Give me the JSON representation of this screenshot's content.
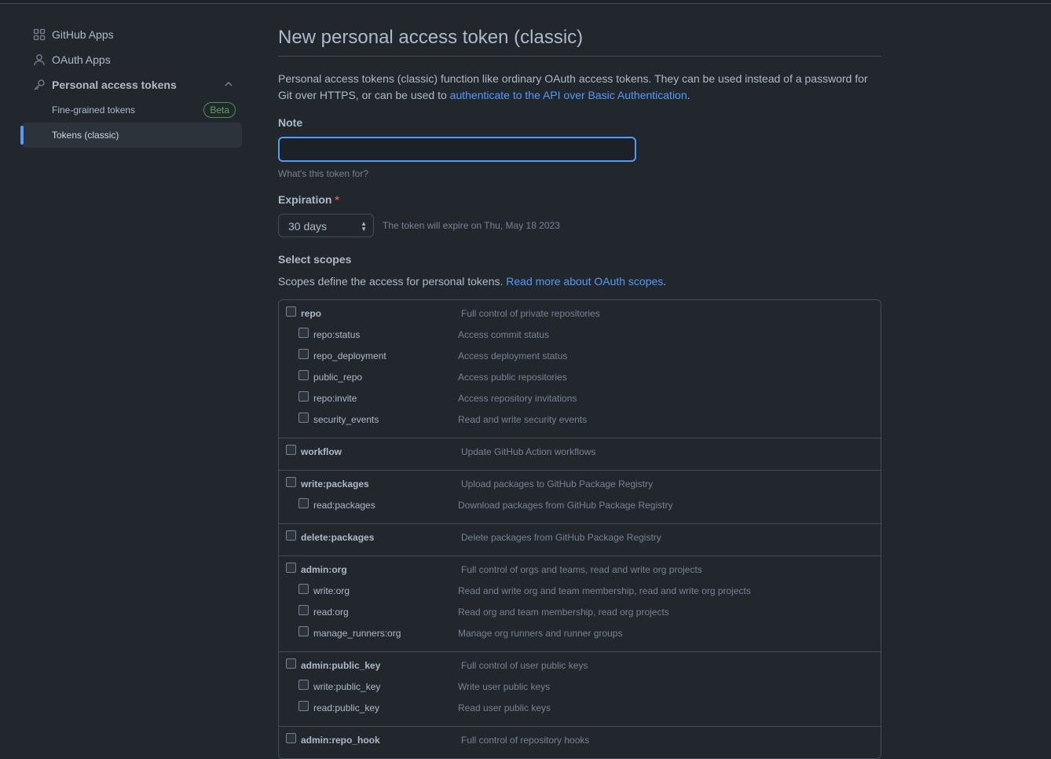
{
  "sidebar": {
    "items": [
      {
        "label": "GitHub Apps",
        "icon": "apps-grid-icon"
      },
      {
        "label": "OAuth Apps",
        "icon": "person-icon"
      },
      {
        "label": "Personal access tokens",
        "icon": "key-icon"
      }
    ],
    "sub_items": [
      {
        "label": "Fine-grained tokens",
        "badge": "Beta"
      },
      {
        "label": "Tokens (classic)",
        "active": true
      }
    ]
  },
  "main": {
    "title": "New personal access token (classic)",
    "description_text": "Personal access tokens (classic) function like ordinary OAuth access tokens. They can be used instead of a password for Git over HTTPS, or can be used to ",
    "description_link": "authenticate to the API over Basic Authentication",
    "description_end": ".",
    "note": {
      "label": "Note",
      "value": "",
      "hint": "What's this token for?"
    },
    "expiration": {
      "label": "Expiration",
      "required_mark": "*",
      "selected": "30 days",
      "note": "The token will expire on Thu, May 18 2023"
    },
    "scopes": {
      "label": "Select scopes",
      "description": "Scopes define the access for personal tokens. ",
      "link": "Read more about OAuth scopes",
      "link_end": ".",
      "groups": [
        {
          "name": "repo",
          "desc": "Full control of private repositories",
          "children": [
            {
              "name": "repo:status",
              "desc": "Access commit status"
            },
            {
              "name": "repo_deployment",
              "desc": "Access deployment status"
            },
            {
              "name": "public_repo",
              "desc": "Access public repositories"
            },
            {
              "name": "repo:invite",
              "desc": "Access repository invitations"
            },
            {
              "name": "security_events",
              "desc": "Read and write security events"
            }
          ]
        },
        {
          "name": "workflow",
          "desc": "Update GitHub Action workflows",
          "children": []
        },
        {
          "name": "write:packages",
          "desc": "Upload packages to GitHub Package Registry",
          "children": [
            {
              "name": "read:packages",
              "desc": "Download packages from GitHub Package Registry"
            }
          ]
        },
        {
          "name": "delete:packages",
          "desc": "Delete packages from GitHub Package Registry",
          "children": []
        },
        {
          "name": "admin:org",
          "desc": "Full control of orgs and teams, read and write org projects",
          "children": [
            {
              "name": "write:org",
              "desc": "Read and write org and team membership, read and write org projects"
            },
            {
              "name": "read:org",
              "desc": "Read org and team membership, read org projects"
            },
            {
              "name": "manage_runners:org",
              "desc": "Manage org runners and runner groups"
            }
          ]
        },
        {
          "name": "admin:public_key",
          "desc": "Full control of user public keys",
          "children": [
            {
              "name": "write:public_key",
              "desc": "Write user public keys"
            },
            {
              "name": "read:public_key",
              "desc": "Read user public keys"
            }
          ]
        },
        {
          "name": "admin:repo_hook",
          "desc": "Full control of repository hooks",
          "children": []
        }
      ]
    }
  },
  "colors": {
    "accent": "#539bf5",
    "background": "#22272e",
    "badge": "#57ab5a",
    "required": "#e5534b"
  }
}
